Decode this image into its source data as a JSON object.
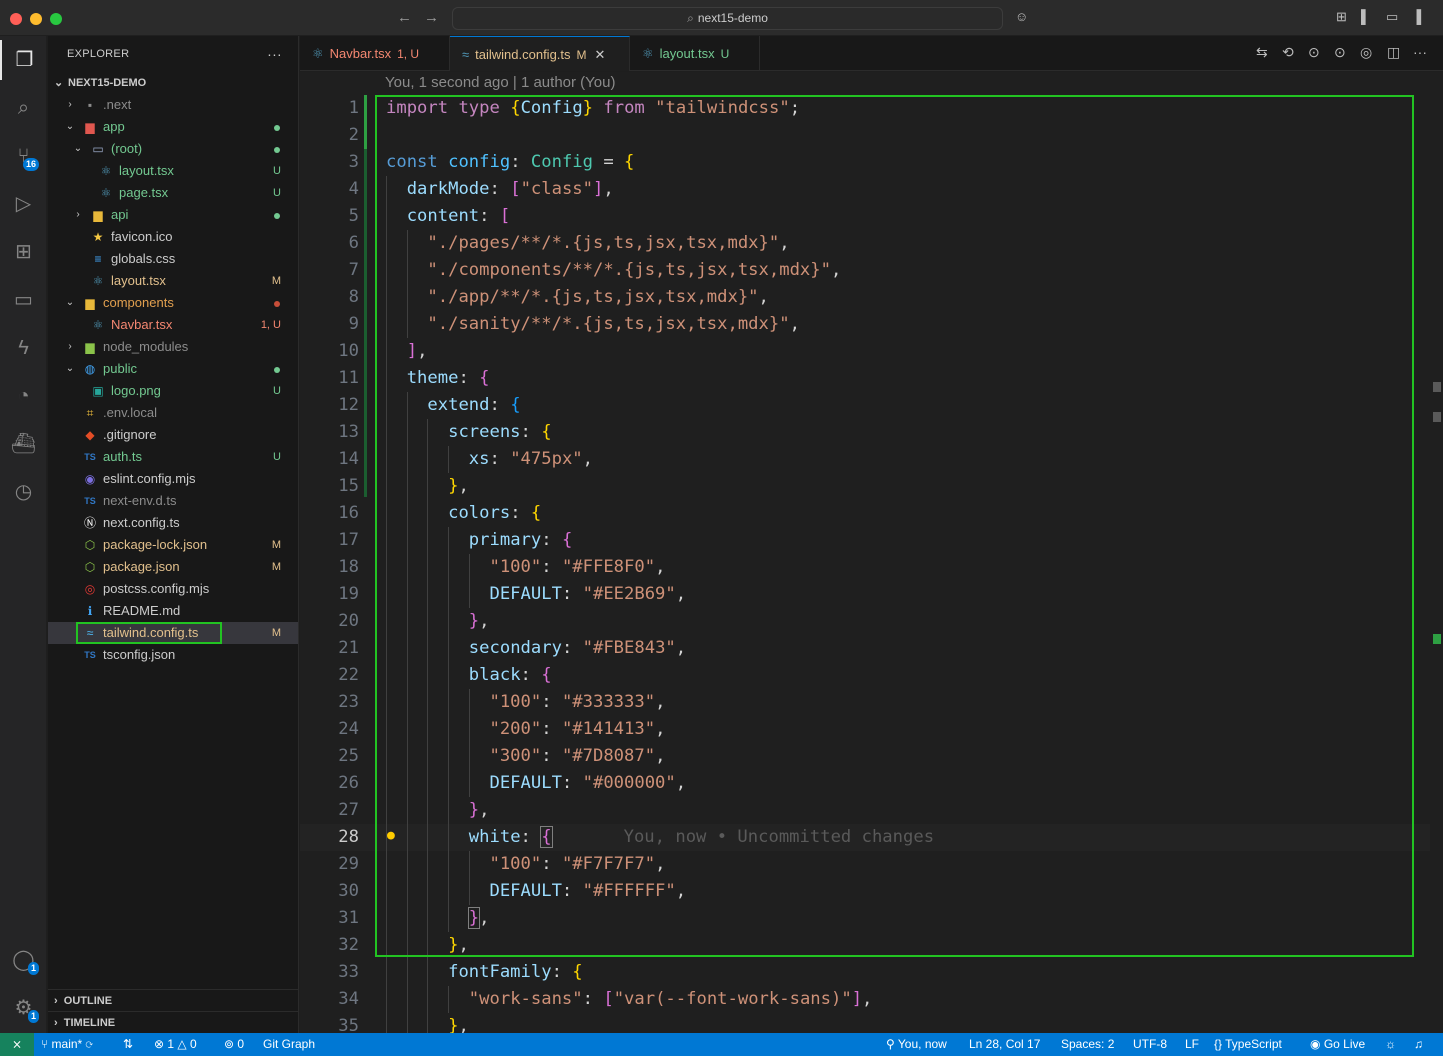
{
  "window": {
    "title": "next15-demo",
    "back_icon": "←",
    "forward_icon": "→",
    "copilot_icon": "☺"
  },
  "activity_bar": {
    "source_control_badge": "16",
    "accounts_badge": "1",
    "settings_badge": "1"
  },
  "explorer": {
    "header": "EXPLORER",
    "more": "···",
    "root_folder": "NEXT15-DEMO",
    "items": [
      {
        "name": ".next",
        "status": "",
        "depth": 1,
        "chev": "›",
        "icon": "▪",
        "icon_color": "#8c8c8c",
        "color": "#8c8c8c",
        "dot": ""
      },
      {
        "name": "app",
        "status": "",
        "depth": 1,
        "chev": "⌄",
        "icon": "▆",
        "icon_color": "#e0574f",
        "color": "#73c991",
        "dot": "#73c991"
      },
      {
        "name": "(root)",
        "status": "",
        "depth": 2,
        "chev": "⌄",
        "icon": "▭",
        "icon_color": "#9aa9c7",
        "color": "#73c991",
        "dot": "#73c991"
      },
      {
        "name": "layout.tsx",
        "status": "U",
        "depth": 3,
        "chev": "",
        "icon": "⚛",
        "icon_color": "#519aba",
        "color": "#73c991",
        "dot": ""
      },
      {
        "name": "page.tsx",
        "status": "U",
        "depth": 3,
        "chev": "",
        "icon": "⚛",
        "icon_color": "#519aba",
        "color": "#73c991",
        "dot": ""
      },
      {
        "name": "api",
        "status": "",
        "depth": 2,
        "chev": "›",
        "icon": "▆",
        "icon_color": "#e8b83a",
        "color": "#73c991",
        "dot": "#73c991"
      },
      {
        "name": "favicon.ico",
        "status": "",
        "depth": 2,
        "chev": "",
        "icon": "★",
        "icon_color": "#f5c842",
        "color": "#cccccc",
        "dot": ""
      },
      {
        "name": "globals.css",
        "status": "",
        "depth": 2,
        "chev": "",
        "icon": "≡",
        "icon_color": "#42a5f5",
        "color": "#cccccc",
        "dot": ""
      },
      {
        "name": "layout.tsx",
        "status": "M",
        "depth": 2,
        "chev": "",
        "icon": "⚛",
        "icon_color": "#519aba",
        "color": "#e2c08d",
        "dot": ""
      },
      {
        "name": "components",
        "status": "",
        "depth": 1,
        "chev": "⌄",
        "icon": "▆",
        "icon_color": "#e8b83a",
        "color": "#e2a04f",
        "dot": "#c74e39"
      },
      {
        "name": "Navbar.tsx",
        "status": "1, U",
        "depth": 2,
        "chev": "",
        "icon": "⚛",
        "icon_color": "#519aba",
        "color": "#f48771",
        "dot": ""
      },
      {
        "name": "node_modules",
        "status": "",
        "depth": 1,
        "chev": "›",
        "icon": "▆",
        "icon_color": "#8bc34a",
        "color": "#8c8c8c",
        "dot": ""
      },
      {
        "name": "public",
        "status": "",
        "depth": 1,
        "chev": "⌄",
        "icon": "◍",
        "icon_color": "#42a5f5",
        "color": "#73c991",
        "dot": "#73c991"
      },
      {
        "name": "logo.png",
        "status": "U",
        "depth": 2,
        "chev": "",
        "icon": "▣",
        "icon_color": "#26a69a",
        "color": "#73c991",
        "dot": ""
      },
      {
        "name": ".env.local",
        "status": "",
        "depth": 1,
        "chev": "",
        "icon": "⌗",
        "icon_color": "#e8b83a",
        "color": "#8c8c8c",
        "dot": ""
      },
      {
        "name": ".gitignore",
        "status": "",
        "depth": 1,
        "chev": "",
        "icon": "◆",
        "icon_color": "#e44d26",
        "color": "#cccccc",
        "dot": ""
      },
      {
        "name": "auth.ts",
        "status": "U",
        "depth": 1,
        "chev": "",
        "icon": "TS",
        "icon_color": "#3178c6",
        "color": "#73c991",
        "dot": ""
      },
      {
        "name": "eslint.config.mjs",
        "status": "",
        "depth": 1,
        "chev": "",
        "icon": "◉",
        "icon_color": "#7c6fe0",
        "color": "#cccccc",
        "dot": ""
      },
      {
        "name": "next-env.d.ts",
        "status": "",
        "depth": 1,
        "chev": "",
        "icon": "TS",
        "icon_color": "#3178c6",
        "color": "#8c8c8c",
        "dot": ""
      },
      {
        "name": "next.config.ts",
        "status": "",
        "depth": 1,
        "chev": "",
        "icon": "Ⓝ",
        "icon_color": "#ffffff",
        "color": "#cccccc",
        "dot": ""
      },
      {
        "name": "package-lock.json",
        "status": "M",
        "depth": 1,
        "chev": "",
        "icon": "⬡",
        "icon_color": "#8bc34a",
        "color": "#e2c08d",
        "dot": ""
      },
      {
        "name": "package.json",
        "status": "M",
        "depth": 1,
        "chev": "",
        "icon": "⬡",
        "icon_color": "#8bc34a",
        "color": "#e2c08d",
        "dot": ""
      },
      {
        "name": "postcss.config.mjs",
        "status": "",
        "depth": 1,
        "chev": "",
        "icon": "◎",
        "icon_color": "#e53935",
        "color": "#cccccc",
        "dot": ""
      },
      {
        "name": "README.md",
        "status": "",
        "depth": 1,
        "chev": "",
        "icon": "ℹ",
        "icon_color": "#42a5f5",
        "color": "#cccccc",
        "dot": ""
      },
      {
        "name": "tailwind.config.ts",
        "status": "M",
        "depth": 1,
        "chev": "",
        "icon": "≈",
        "icon_color": "#4fc1ff",
        "color": "#e2c08d",
        "dot": "",
        "selected": true
      },
      {
        "name": "tsconfig.json",
        "status": "",
        "depth": 1,
        "chev": "",
        "icon": "TS",
        "icon_color": "#3178c6",
        "color": "#cccccc",
        "dot": ""
      }
    ],
    "outline": "OUTLINE",
    "timeline": "TIMELINE"
  },
  "tabs": [
    {
      "label": "Navbar.tsx",
      "status": "1, U",
      "color": "#f48771",
      "icon": "⚛"
    },
    {
      "label": "tailwind.config.ts",
      "status": "M",
      "color": "#e2c08d",
      "icon": "≈",
      "active": true,
      "close": "✕"
    },
    {
      "label": "layout.tsx",
      "status": "U",
      "color": "#73c991",
      "icon": "⚛"
    }
  ],
  "editor": {
    "blame": "You, 1 second ago | 1 author (You)",
    "inline_blame": "You, now • Uncommitted changes",
    "current_line": 28,
    "lines": [
      {
        "n": 1,
        "t": [
          [
            "k-ctl",
            "import"
          ],
          [
            "k-pun",
            " "
          ],
          [
            "k-ctl",
            "type"
          ],
          [
            "k-pun",
            " "
          ],
          [
            "b1",
            "{"
          ],
          [
            "k-prop",
            "Config"
          ],
          [
            "b1",
            "}"
          ],
          [
            "k-pun",
            " "
          ],
          [
            "k-ctl",
            "from"
          ],
          [
            "k-pun",
            " "
          ],
          [
            "k-str",
            "\"tailwindcss\""
          ],
          [
            "k-pun",
            ";"
          ]
        ]
      },
      {
        "n": 2,
        "t": []
      },
      {
        "n": 3,
        "t": [
          [
            "k-kw",
            "const"
          ],
          [
            "k-pun",
            " "
          ],
          [
            "k-var",
            "config"
          ],
          [
            "k-pun",
            ": "
          ],
          [
            "k-type",
            "Config"
          ],
          [
            "k-pun",
            " = "
          ],
          [
            "b1",
            "{"
          ]
        ]
      },
      {
        "n": 4,
        "t": [
          [
            "k-pun",
            "  "
          ],
          [
            "k-prop",
            "darkMode"
          ],
          [
            "k-pun",
            ": "
          ],
          [
            "b2",
            "["
          ],
          [
            "k-str",
            "\"class\""
          ],
          [
            "b2",
            "]"
          ],
          [
            "k-pun",
            ","
          ]
        ]
      },
      {
        "n": 5,
        "t": [
          [
            "k-pun",
            "  "
          ],
          [
            "k-prop",
            "content"
          ],
          [
            "k-pun",
            ": "
          ],
          [
            "b2",
            "["
          ]
        ]
      },
      {
        "n": 6,
        "t": [
          [
            "k-pun",
            "    "
          ],
          [
            "k-str",
            "\"./pages/**/*.{js,ts,jsx,tsx,mdx}\""
          ],
          [
            "k-pun",
            ","
          ]
        ]
      },
      {
        "n": 7,
        "t": [
          [
            "k-pun",
            "    "
          ],
          [
            "k-str",
            "\"./components/**/*.{js,ts,jsx,tsx,mdx}\""
          ],
          [
            "k-pun",
            ","
          ]
        ]
      },
      {
        "n": 8,
        "t": [
          [
            "k-pun",
            "    "
          ],
          [
            "k-str",
            "\"./app/**/*.{js,ts,jsx,tsx,mdx}\""
          ],
          [
            "k-pun",
            ","
          ]
        ]
      },
      {
        "n": 9,
        "t": [
          [
            "k-pun",
            "    "
          ],
          [
            "k-str",
            "\"./sanity/**/*.{js,ts,jsx,tsx,mdx}\""
          ],
          [
            "k-pun",
            ","
          ]
        ]
      },
      {
        "n": 10,
        "t": [
          [
            "k-pun",
            "  "
          ],
          [
            "b2",
            "]"
          ],
          [
            "k-pun",
            ","
          ]
        ]
      },
      {
        "n": 11,
        "t": [
          [
            "k-pun",
            "  "
          ],
          [
            "k-prop",
            "theme"
          ],
          [
            "k-pun",
            ": "
          ],
          [
            "b2",
            "{"
          ]
        ]
      },
      {
        "n": 12,
        "t": [
          [
            "k-pun",
            "    "
          ],
          [
            "k-prop",
            "extend"
          ],
          [
            "k-pun",
            ": "
          ],
          [
            "b3",
            "{"
          ]
        ]
      },
      {
        "n": 13,
        "t": [
          [
            "k-pun",
            "      "
          ],
          [
            "k-prop",
            "screens"
          ],
          [
            "k-pun",
            ": "
          ],
          [
            "b1",
            "{"
          ]
        ]
      },
      {
        "n": 14,
        "t": [
          [
            "k-pun",
            "        "
          ],
          [
            "k-prop",
            "xs"
          ],
          [
            "k-pun",
            ": "
          ],
          [
            "k-str",
            "\"475px\""
          ],
          [
            "k-pun",
            ","
          ]
        ]
      },
      {
        "n": 15,
        "t": [
          [
            "k-pun",
            "      "
          ],
          [
            "b1",
            "}"
          ],
          [
            "k-pun",
            ","
          ]
        ]
      },
      {
        "n": 16,
        "t": [
          [
            "k-pun",
            "      "
          ],
          [
            "k-prop",
            "colors"
          ],
          [
            "k-pun",
            ": "
          ],
          [
            "b1",
            "{"
          ]
        ]
      },
      {
        "n": 17,
        "t": [
          [
            "k-pun",
            "        "
          ],
          [
            "k-prop",
            "primary"
          ],
          [
            "k-pun",
            ": "
          ],
          [
            "b2",
            "{"
          ]
        ]
      },
      {
        "n": 18,
        "t": [
          [
            "k-pun",
            "          "
          ],
          [
            "k-str",
            "\"100\""
          ],
          [
            "k-pun",
            ": "
          ],
          [
            "k-str",
            "\"#FFE8F0\""
          ],
          [
            "k-pun",
            ","
          ]
        ]
      },
      {
        "n": 19,
        "t": [
          [
            "k-pun",
            "          "
          ],
          [
            "k-prop",
            "DEFAULT"
          ],
          [
            "k-pun",
            ": "
          ],
          [
            "k-str",
            "\"#EE2B69\""
          ],
          [
            "k-pun",
            ","
          ]
        ]
      },
      {
        "n": 20,
        "t": [
          [
            "k-pun",
            "        "
          ],
          [
            "b2",
            "}"
          ],
          [
            "k-pun",
            ","
          ]
        ]
      },
      {
        "n": 21,
        "t": [
          [
            "k-pun",
            "        "
          ],
          [
            "k-prop",
            "secondary"
          ],
          [
            "k-pun",
            ": "
          ],
          [
            "k-str",
            "\"#FBE843\""
          ],
          [
            "k-pun",
            ","
          ]
        ]
      },
      {
        "n": 22,
        "t": [
          [
            "k-pun",
            "        "
          ],
          [
            "k-prop",
            "black"
          ],
          [
            "k-pun",
            ": "
          ],
          [
            "b2",
            "{"
          ]
        ]
      },
      {
        "n": 23,
        "t": [
          [
            "k-pun",
            "          "
          ],
          [
            "k-str",
            "\"100\""
          ],
          [
            "k-pun",
            ": "
          ],
          [
            "k-str",
            "\"#333333\""
          ],
          [
            "k-pun",
            ","
          ]
        ]
      },
      {
        "n": 24,
        "t": [
          [
            "k-pun",
            "          "
          ],
          [
            "k-str",
            "\"200\""
          ],
          [
            "k-pun",
            ": "
          ],
          [
            "k-str",
            "\"#141413\""
          ],
          [
            "k-pun",
            ","
          ]
        ]
      },
      {
        "n": 25,
        "t": [
          [
            "k-pun",
            "          "
          ],
          [
            "k-str",
            "\"300\""
          ],
          [
            "k-pun",
            ": "
          ],
          [
            "k-str",
            "\"#7D8087\""
          ],
          [
            "k-pun",
            ","
          ]
        ]
      },
      {
        "n": 26,
        "t": [
          [
            "k-pun",
            "          "
          ],
          [
            "k-prop",
            "DEFAULT"
          ],
          [
            "k-pun",
            ": "
          ],
          [
            "k-str",
            "\"#000000\""
          ],
          [
            "k-pun",
            ","
          ]
        ]
      },
      {
        "n": 27,
        "t": [
          [
            "k-pun",
            "        "
          ],
          [
            "b2",
            "}"
          ],
          [
            "k-pun",
            ","
          ]
        ]
      },
      {
        "n": 28,
        "t": [
          [
            "k-pun",
            "        "
          ],
          [
            "k-prop",
            "white"
          ],
          [
            "k-pun",
            ": "
          ],
          [
            "b2 bracket-box",
            "{"
          ]
        ],
        "ghost": true
      },
      {
        "n": 29,
        "t": [
          [
            "k-pun",
            "          "
          ],
          [
            "k-str",
            "\"100\""
          ],
          [
            "k-pun",
            ": "
          ],
          [
            "k-str",
            "\"#F7F7F7\""
          ],
          [
            "k-pun",
            ","
          ]
        ]
      },
      {
        "n": 30,
        "t": [
          [
            "k-pun",
            "          "
          ],
          [
            "k-prop",
            "DEFAULT"
          ],
          [
            "k-pun",
            ": "
          ],
          [
            "k-str",
            "\"#FFFFFF\""
          ],
          [
            "k-pun",
            ","
          ]
        ]
      },
      {
        "n": 31,
        "t": [
          [
            "k-pun",
            "        "
          ],
          [
            "b2 bracket-box",
            "}"
          ],
          [
            "k-pun",
            ","
          ]
        ]
      },
      {
        "n": 32,
        "t": [
          [
            "k-pun",
            "      "
          ],
          [
            "b1",
            "}"
          ],
          [
            "k-pun",
            ","
          ]
        ]
      },
      {
        "n": 33,
        "t": [
          [
            "k-pun",
            "      "
          ],
          [
            "k-prop",
            "fontFamily"
          ],
          [
            "k-pun",
            ": "
          ],
          [
            "b1",
            "{"
          ]
        ]
      },
      {
        "n": 34,
        "t": [
          [
            "k-pun",
            "        "
          ],
          [
            "k-str",
            "\"work-sans\""
          ],
          [
            "k-pun",
            ": "
          ],
          [
            "b2",
            "["
          ],
          [
            "k-str",
            "\"var(--font-work-sans)\""
          ],
          [
            "b2",
            "]"
          ],
          [
            "k-pun",
            ","
          ]
        ]
      },
      {
        "n": 35,
        "t": [
          [
            "k-pun",
            "      "
          ],
          [
            "b1",
            "}"
          ],
          [
            "k-pun",
            ","
          ]
        ]
      }
    ]
  },
  "status_bar": {
    "remote_icon": "⨯",
    "branch": "main*",
    "sync_icon": "⟳",
    "errors": "1",
    "warnings": "0",
    "ports": "0",
    "git_graph": "Git Graph",
    "blame": "You, now",
    "cursor": "Ln 28, Col 17",
    "spaces": "Spaces: 2",
    "encoding": "UTF-8",
    "eol": "LF",
    "language": "TypeScript",
    "golive": "Go Live"
  },
  "colors": {
    "accent": "#0078d4",
    "highlight_box": "#22c322"
  }
}
